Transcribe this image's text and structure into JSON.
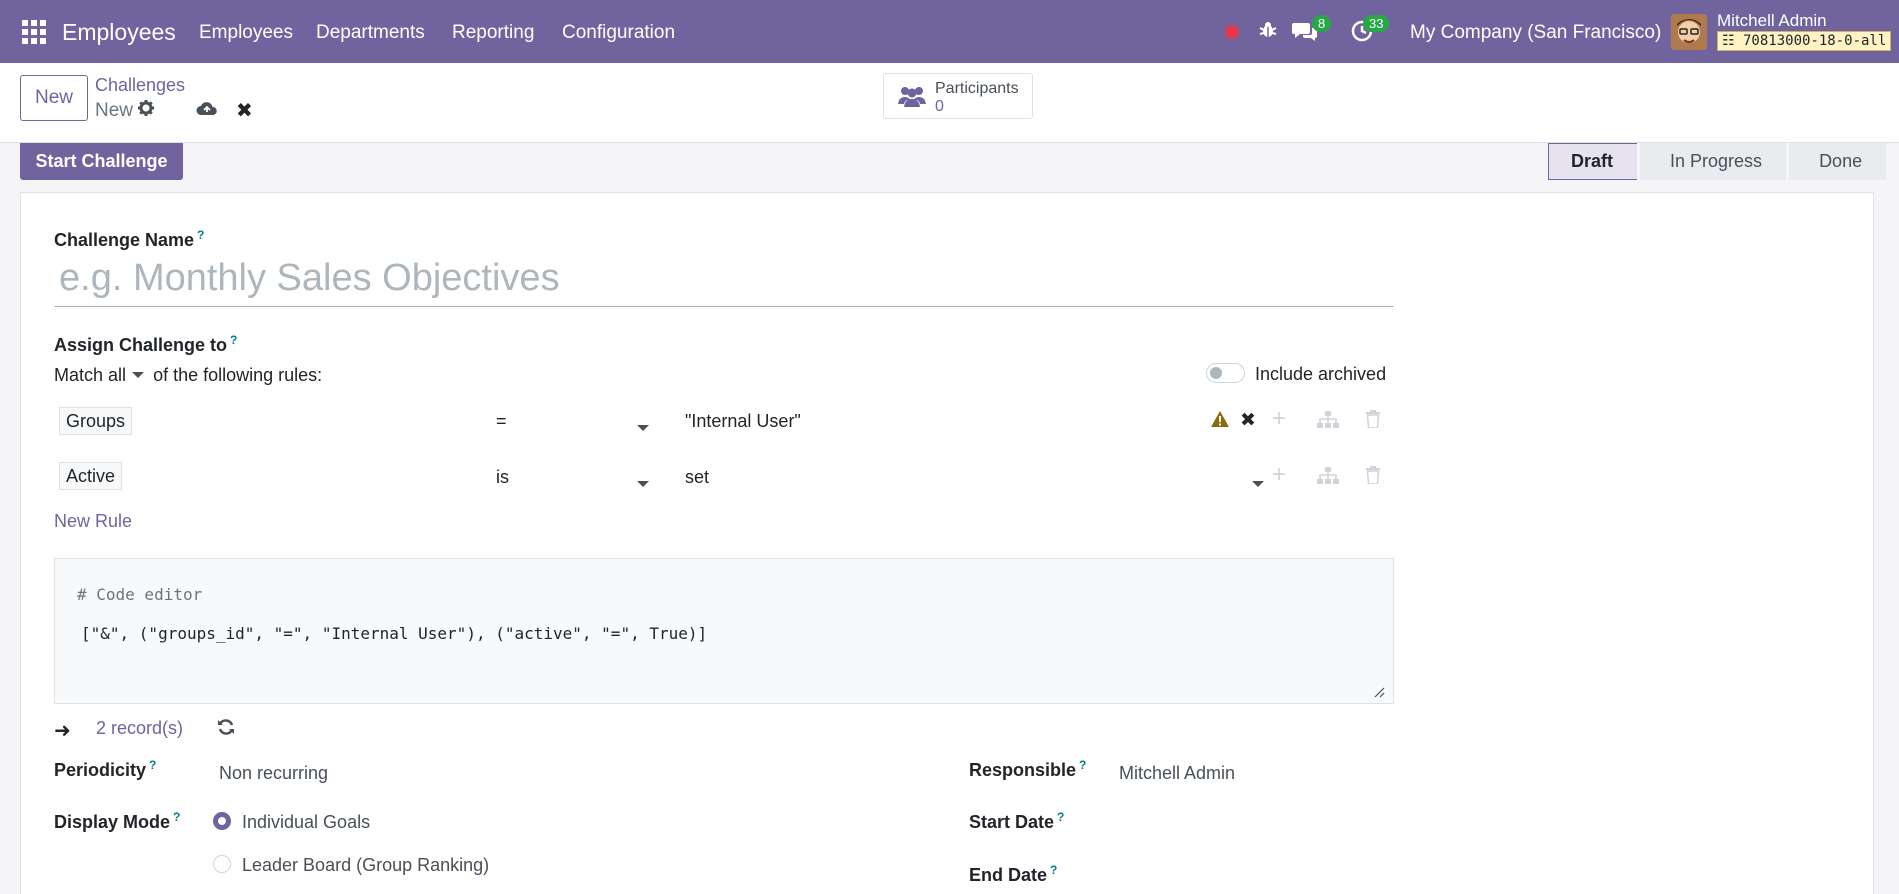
{
  "navbar": {
    "brand": "Employees",
    "menu": [
      "Employees",
      "Departments",
      "Reporting",
      "Configuration"
    ],
    "chat_count": "8",
    "activity_count": "33",
    "company": "My Company (San Francisco)",
    "user": "Mitchell Admin",
    "db": "70813000-18-0-all"
  },
  "control": {
    "new_label": "New",
    "breadcrumb": "Challenges",
    "record": "New",
    "participants_label": "Participants",
    "participants_count": "0"
  },
  "statusbar": {
    "start_label": "Start Challenge",
    "stages": [
      "Draft",
      "In Progress",
      "Done"
    ]
  },
  "form": {
    "name_label": "Challenge Name",
    "name_placeholder": "e.g. Monthly Sales Objectives",
    "assign_label": "Assign Challenge to",
    "match_prefix": "Match",
    "match_value": "all",
    "match_suffix": "of the following rules:",
    "include_archived": "Include archived",
    "rules": [
      {
        "field": "Groups",
        "op": "=",
        "value": "\"Internal User\""
      },
      {
        "field": "Active",
        "op": "is",
        "value": "set"
      }
    ],
    "new_rule": "New Rule",
    "code_comment": "# Code editor",
    "code": "[\"&\", (\"groups_id\", \"=\", \"Internal User\"), (\"active\", \"=\", True)]",
    "records": "2 record(s)",
    "periodicity_label": "Periodicity",
    "periodicity_value": "Non recurring",
    "display_mode_label": "Display Mode",
    "display_options": [
      "Individual Goals",
      "Leader Board (Group Ranking)"
    ],
    "responsible_label": "Responsible",
    "responsible_value": "Mitchell Admin",
    "start_date_label": "Start Date",
    "end_date_label": "End Date"
  },
  "colors": {
    "brand": "#71639e",
    "badge": "#28a745",
    "record_dot": "#e0394b"
  }
}
